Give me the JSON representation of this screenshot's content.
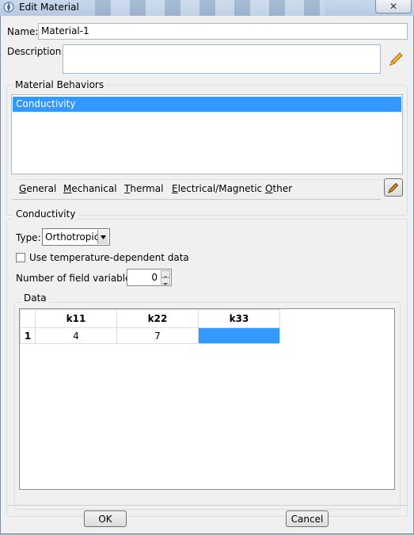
{
  "window": {
    "title": "Edit Material"
  },
  "name": {
    "label": "Name:",
    "value": "Material-1"
  },
  "description": {
    "label": "Description:",
    "value": ""
  },
  "behaviors": {
    "title": "Material Behaviors",
    "items": [
      "Conductivity"
    ],
    "selected": "Conductivity"
  },
  "menubar": {
    "general": {
      "first": "G",
      "rest": "eneral"
    },
    "mechanical": {
      "first": "M",
      "rest": "echanical"
    },
    "thermal": {
      "first": "T",
      "rest": "hermal"
    },
    "electrical": {
      "first": "E",
      "rest": "lectrical/Magnetic"
    },
    "other": {
      "first": "O",
      "rest": "ther"
    }
  },
  "conductivity": {
    "title": "Conductivity",
    "type_label": "Type:",
    "type_value": "Orthotropic",
    "temp_label": "Use temperature-dependent data",
    "field_vars_label": "Number of field variables:",
    "field_vars_value": "0"
  },
  "data_table": {
    "title": "Data",
    "columns": [
      "k11",
      "k22",
      "k33"
    ],
    "rows": [
      {
        "index": "1",
        "values": [
          "4",
          "7",
          ""
        ]
      }
    ]
  },
  "buttons": {
    "ok": "OK",
    "cancel": "Cancel"
  },
  "colors": {
    "selection": "#3399ff"
  }
}
